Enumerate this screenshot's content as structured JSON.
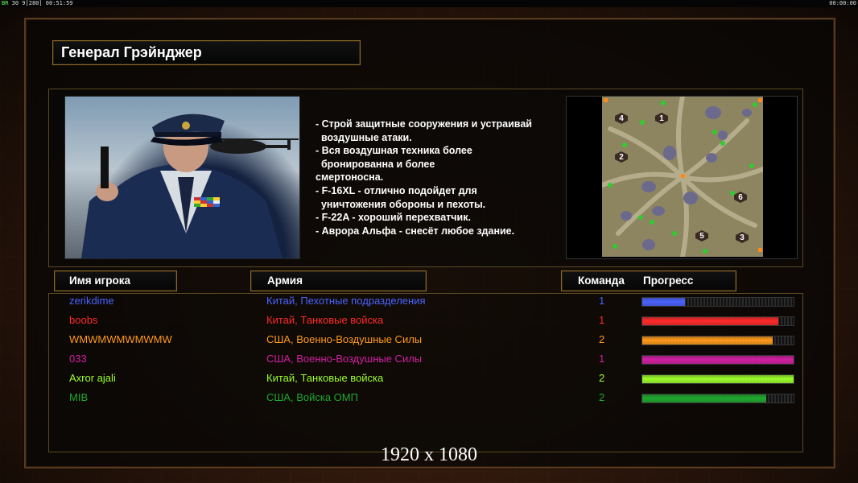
{
  "topbar": {
    "fps_label": "ВR",
    "fps_values": "30 9[280] 00:51:59",
    "clock": "00:00:00"
  },
  "general": {
    "name": "Генерал Грэйнджер",
    "description": [
      "- Строй защитные сооружения и устраивай",
      "  воздушные атаки.",
      "- Вся воздушная техника более",
      "  бронированна и более",
      "смертоносна.",
      "- F-16XL - отлично подойдет для",
      "  уничтожения обороны и пехоты.",
      "- F-22A - хороший перехватчик.",
      "- Аврора Альфа - снесёт любое здание."
    ]
  },
  "minimap": {
    "start_positions": [
      "1",
      "2",
      "3",
      "4",
      "5",
      "6"
    ]
  },
  "table": {
    "headers": {
      "player": "Имя игрока",
      "army": "Армия",
      "team": "Команда",
      "progress": "Прогресс"
    },
    "rows": [
      {
        "name": "zerikdime",
        "army": "Китай, Пехотные подразделения",
        "team": "1",
        "progress": 0.28,
        "color": "#4a63ff"
      },
      {
        "name": "boobs",
        "army": "Китай, Танковые войска",
        "team": "1",
        "progress": 0.9,
        "color": "#ff2a2a"
      },
      {
        "name": "WMWMWMWMWMW",
        "army": "США, Военно-Воздушные Силы",
        "team": "2",
        "progress": 0.86,
        "color": "#ff9a1a"
      },
      {
        "name": "033",
        "army": "США, Военно-Воздушные Силы",
        "team": "1",
        "progress": 1.0,
        "color": "#d21fa2"
      },
      {
        "name": "Axror ajali",
        "army": "Китай, Танковые войска",
        "team": "2",
        "progress": 1.0,
        "color": "#9cff2a"
      },
      {
        "name": "MIB",
        "army": "США, Войска ОМП",
        "team": "2",
        "progress": 0.82,
        "color": "#1fa82e"
      }
    ]
  },
  "resolution": "1920 x 1080"
}
